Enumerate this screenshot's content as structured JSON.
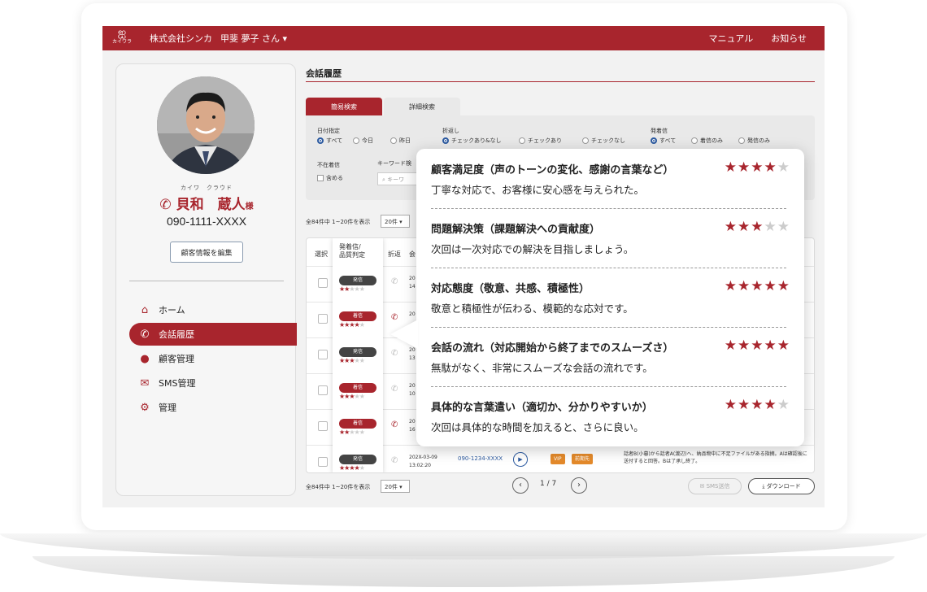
{
  "header": {
    "logo_text": "カイワラ",
    "company": "株式会社シンカ",
    "user": "甲斐 夢子 さん ▾",
    "links": [
      "マニュアル",
      "お知らせ"
    ]
  },
  "sidebar": {
    "kana": "カイワ　クラウド",
    "name": "貝和　蔵人",
    "honorific": "様",
    "phone": "090-1111-XXXX",
    "edit_button": "顧客情報を編集",
    "nav": [
      {
        "label": "ホーム",
        "icon": "home-icon"
      },
      {
        "label": "会話履歴",
        "icon": "phone-icon",
        "active": true
      },
      {
        "label": "顧客管理",
        "icon": "user-icon"
      },
      {
        "label": "SMS管理",
        "icon": "mail-icon"
      },
      {
        "label": "管理",
        "icon": "gear-icon"
      }
    ]
  },
  "main": {
    "title": "会話履歴",
    "tabs": [
      "簡易検索",
      "詳細検索"
    ],
    "search": {
      "date_label": "日付指定",
      "date_options": [
        "すべて",
        "今日",
        "昨日"
      ],
      "callback_label": "折返し",
      "callback_options": [
        "チェックあり&なし",
        "チェックあり",
        "チェックなし"
      ],
      "direction_label": "発着信",
      "direction_options": [
        "すべて",
        "着信のみ",
        "発信のみ"
      ],
      "absent_label": "不在着信",
      "absent_option": "含める",
      "keyword_label": "キーワード検",
      "keyword_placeholder": "キーワ"
    },
    "total_text": "全84件中 1~20件を表示",
    "per_page": "20件 ▾",
    "table_headers": {
      "select": "選択",
      "direction": "発着信/\n品質判定",
      "callback": "折返",
      "conversation": "会"
    },
    "rows": [
      {
        "type": "発信",
        "kind": "out",
        "stars": 2,
        "date": "20",
        "time": "14",
        "red_phone": false
      },
      {
        "type": "着信",
        "kind": "in",
        "stars": 4,
        "date": "20",
        "time": "",
        "red_phone": true
      },
      {
        "type": "発信",
        "kind": "out",
        "stars": 3,
        "date": "20",
        "time": "13",
        "red_phone": false
      },
      {
        "type": "着信",
        "kind": "in",
        "stars": 3,
        "date": "20",
        "time": "10",
        "red_phone": false
      },
      {
        "type": "着信",
        "kind": "in",
        "stars": 2,
        "date": "20",
        "time": "16",
        "red_phone": true
      },
      {
        "type": "発信",
        "kind": "out",
        "stars": 4,
        "date": "202X-03-09",
        "time": "13:02:20",
        "red_phone": false
      }
    ],
    "last_row": {
      "number": "090-1234-XXXX",
      "tag_vip": "VIP",
      "tag_recent": "前期先",
      "text": "話者B(小暮)から話者A(渡辺)へ、納品物中に不足ファイルがある指摘。Aは確認後に送付すると回答。Bは了承し終了。"
    },
    "pager": {
      "total_text": "全84件中 1~20件を表示",
      "per_page": "20件 ▾",
      "page": "1 / 7",
      "prev": "‹",
      "next": "›",
      "sms_button": "✉ SMS送信",
      "download_button": "⤓ ダウンロード"
    }
  },
  "popup": {
    "items": [
      {
        "title": "顧客満足度（声のトーンの変化、感謝の言葉など）",
        "desc": "丁寧な対応で、お客様に安心感を与えられた。",
        "stars": 4
      },
      {
        "title": "問題解決策（課題解決への貢献度）",
        "desc": "次回は一次対応での解決を目指しましょう。",
        "stars": 3
      },
      {
        "title": "対応態度（敬意、共感、積極性）",
        "desc": "敬意と積極性が伝わる、模範的な応対です。",
        "stars": 5
      },
      {
        "title": "会話の流れ（対応開始から終了までのスムーズさ）",
        "desc": "無駄がなく、非常にスムーズな会話の流れです。",
        "stars": 5
      },
      {
        "title": "具体的な言葉遣い（適切か、分かりやすいか）",
        "desc": "次回は具体的な時間を加えると、さらに良い。",
        "stars": 4
      }
    ]
  },
  "colors": {
    "brand": "#a8252d",
    "link": "#2c5aa0"
  }
}
